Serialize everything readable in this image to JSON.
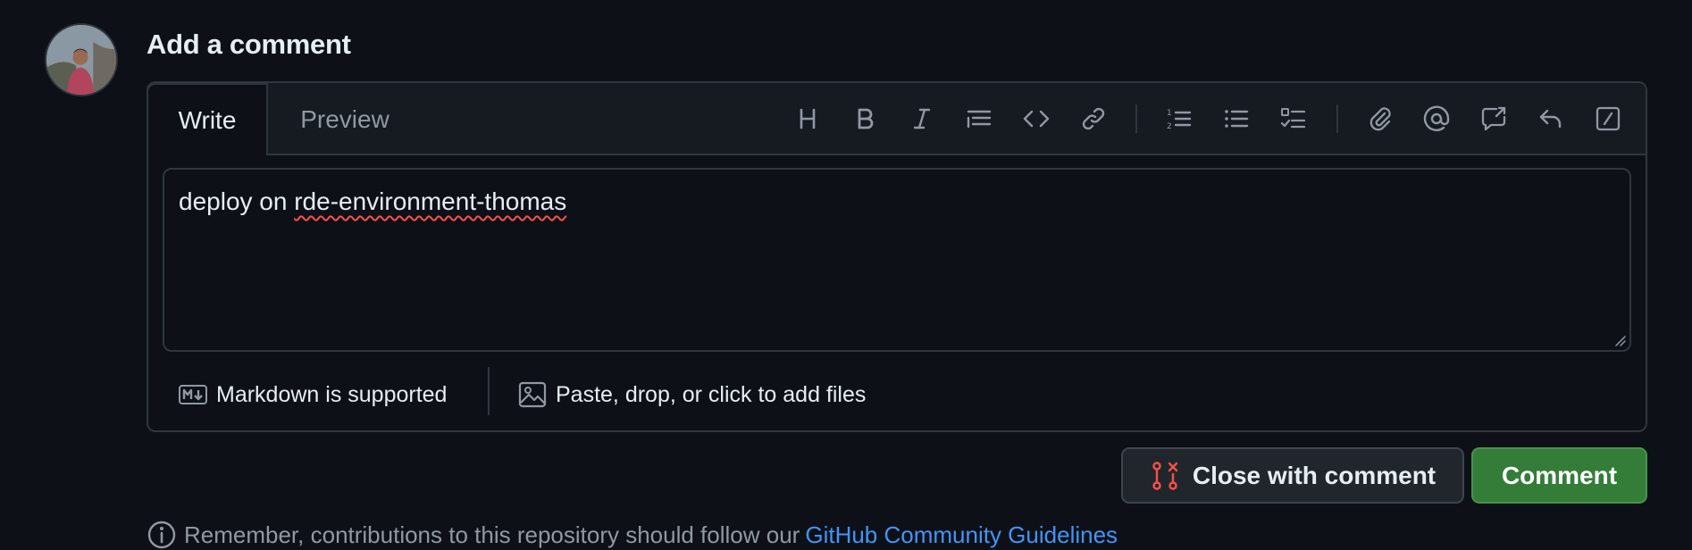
{
  "avatar": {
    "alt": "user avatar"
  },
  "title": "Add a comment",
  "tabs": [
    {
      "label": "Write",
      "active": true
    },
    {
      "label": "Preview",
      "active": false
    }
  ],
  "toolbar": {
    "buttons": [
      {
        "icon": "heading-icon"
      },
      {
        "icon": "bold-icon"
      },
      {
        "icon": "italic-icon"
      },
      {
        "icon": "quote-icon"
      },
      {
        "icon": "code-icon"
      },
      {
        "icon": "link-icon"
      },
      {
        "icon": "ordered-list-icon"
      },
      {
        "icon": "unordered-list-icon"
      },
      {
        "icon": "task-list-icon"
      },
      {
        "icon": "attach-icon"
      },
      {
        "icon": "mention-icon"
      },
      {
        "icon": "cross-reference-icon"
      },
      {
        "icon": "reply-icon"
      },
      {
        "icon": "slash-command-icon"
      }
    ]
  },
  "editor": {
    "text_prefix": "deploy on ",
    "text_misspelled": "rde-environment-thomas"
  },
  "footer": {
    "markdown_label": "Markdown is supported",
    "files_label": "Paste, drop, or click to add files"
  },
  "actions": {
    "close_label": "Close with comment",
    "comment_label": "Comment"
  },
  "notice": {
    "text": "Remember, contributions to this repository should follow our",
    "link": "GitHub Community Guidelines"
  },
  "colors": {
    "background": "#0d1117",
    "header": "#161b22",
    "border": "#30363d",
    "primary_green": "#347d39",
    "link_blue": "#4493f8",
    "danger_red": "#f85149"
  }
}
